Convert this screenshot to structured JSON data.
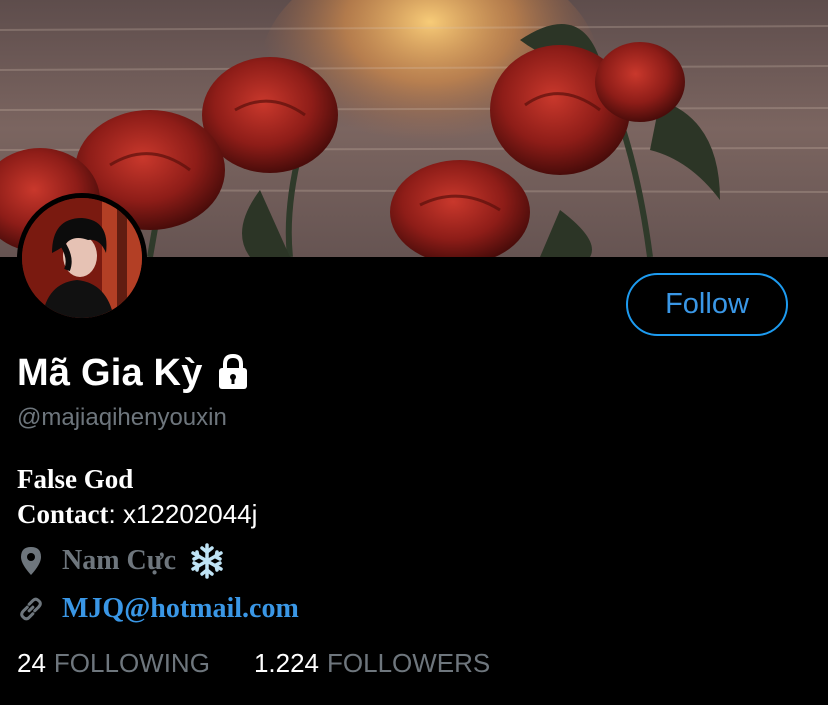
{
  "profile": {
    "name": "Mã Gia Kỳ",
    "handle": "@majiaqihenyouxin",
    "follow_label": "Follow",
    "bio_line1": "False God",
    "contact_label": "Contact",
    "contact_sep": ":",
    "contact_value": " x12202044j",
    "location": "Nam Cực",
    "link": "MJQ@hotmail.com"
  },
  "stats": {
    "following_count": "24",
    "following_label": "FOLLOWING",
    "followers_count": "1.224",
    "followers_label": "FOLLOWERS"
  },
  "icons": {
    "lock": "lock-icon",
    "location": "location-pin-icon",
    "link": "link-icon",
    "snowflake": "snowflake-icon"
  },
  "colors": {
    "background": "#000000",
    "accent": "#1d9bf0",
    "muted": "#6e767d",
    "text": "#ffffff"
  }
}
